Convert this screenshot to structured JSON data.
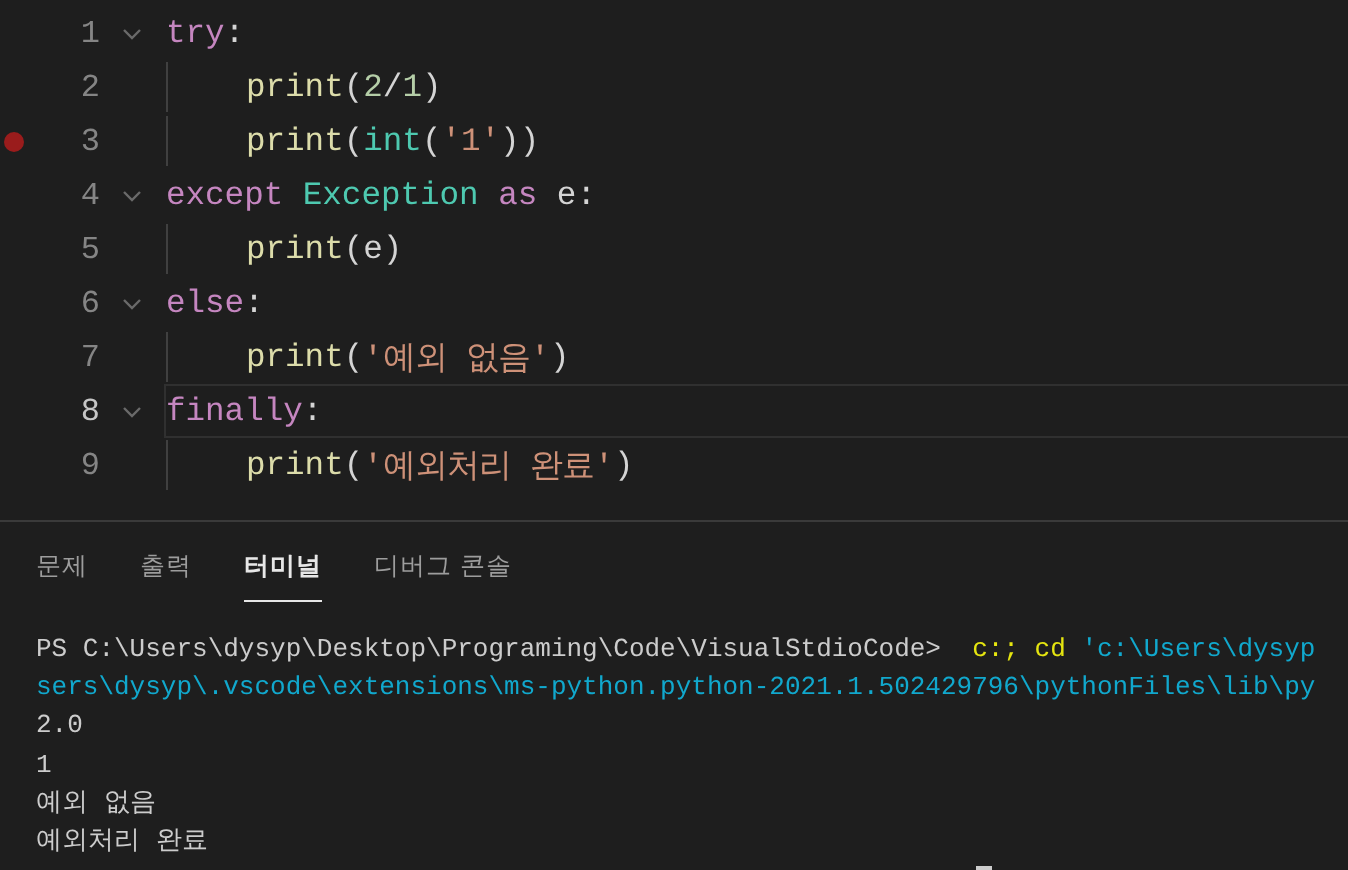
{
  "editor": {
    "lines": [
      {
        "number": "1",
        "foldable": true,
        "breakpoint": false,
        "current": false,
        "indented": false,
        "tokens": [
          {
            "kind": "keyword",
            "text": "try"
          },
          {
            "kind": "plain",
            "text": ":"
          }
        ]
      },
      {
        "number": "2",
        "foldable": false,
        "breakpoint": false,
        "current": false,
        "indented": true,
        "tokens": [
          {
            "kind": "func",
            "text": "print"
          },
          {
            "kind": "plain",
            "text": "("
          },
          {
            "kind": "number",
            "text": "2"
          },
          {
            "kind": "plain",
            "text": "/"
          },
          {
            "kind": "number",
            "text": "1"
          },
          {
            "kind": "plain",
            "text": ")"
          }
        ]
      },
      {
        "number": "3",
        "foldable": false,
        "breakpoint": true,
        "current": false,
        "indented": true,
        "tokens": [
          {
            "kind": "func",
            "text": "print"
          },
          {
            "kind": "plain",
            "text": "("
          },
          {
            "kind": "class",
            "text": "int"
          },
          {
            "kind": "plain",
            "text": "("
          },
          {
            "kind": "string",
            "text": "'1'"
          },
          {
            "kind": "plain",
            "text": "))"
          }
        ]
      },
      {
        "number": "4",
        "foldable": true,
        "breakpoint": false,
        "current": false,
        "indented": false,
        "tokens": [
          {
            "kind": "keyword",
            "text": "except"
          },
          {
            "kind": "class",
            "text": " Exception"
          },
          {
            "kind": "keyword",
            "text": " as"
          },
          {
            "kind": "plain",
            "text": " e:"
          }
        ]
      },
      {
        "number": "5",
        "foldable": false,
        "breakpoint": false,
        "current": false,
        "indented": true,
        "tokens": [
          {
            "kind": "func",
            "text": "print"
          },
          {
            "kind": "plain",
            "text": "(e)"
          }
        ]
      },
      {
        "number": "6",
        "foldable": true,
        "breakpoint": false,
        "current": false,
        "indented": false,
        "tokens": [
          {
            "kind": "keyword",
            "text": "else"
          },
          {
            "kind": "plain",
            "text": ":"
          }
        ]
      },
      {
        "number": "7",
        "foldable": false,
        "breakpoint": false,
        "current": false,
        "indented": true,
        "tokens": [
          {
            "kind": "func",
            "text": "print"
          },
          {
            "kind": "plain",
            "text": "("
          },
          {
            "kind": "string",
            "text": "'예외 없음'"
          },
          {
            "kind": "plain",
            "text": ")"
          }
        ]
      },
      {
        "number": "8",
        "foldable": true,
        "breakpoint": false,
        "current": true,
        "indented": false,
        "tokens": [
          {
            "kind": "keyword",
            "text": "finally"
          },
          {
            "kind": "plain",
            "text": ":"
          }
        ]
      },
      {
        "number": "9",
        "foldable": false,
        "breakpoint": false,
        "current": false,
        "indented": true,
        "tokens": [
          {
            "kind": "func",
            "text": "print"
          },
          {
            "kind": "plain",
            "text": "("
          },
          {
            "kind": "string",
            "text": "'예외처리 완료'"
          },
          {
            "kind": "plain",
            "text": ")"
          }
        ]
      }
    ]
  },
  "panel": {
    "tabs": [
      {
        "label": "문제",
        "selected": false
      },
      {
        "label": "출력",
        "selected": false
      },
      {
        "label": "터미널",
        "selected": true
      },
      {
        "label": "디버그 콘솔",
        "selected": false
      }
    ],
    "terminal": [
      [
        {
          "kind": "plain",
          "text": "PS C:\\Users\\dysyp\\Desktop\\Programing\\Code\\VisualStdioCode>  "
        },
        {
          "kind": "command",
          "text": "c:; cd"
        },
        {
          "kind": "arg",
          "text": " 'c:\\Users\\dysyp"
        }
      ],
      [
        {
          "kind": "arg",
          "text": "sers\\dysyp\\.vscode\\extensions\\ms-python.python-2021.1.502429796\\pythonFiles\\lib\\py"
        }
      ],
      [
        {
          "kind": "plain",
          "text": "2.0"
        }
      ],
      [
        {
          "kind": "plain",
          "text": "1"
        }
      ],
      [
        {
          "kind": "plain",
          "text": "예외 없음"
        }
      ],
      [
        {
          "kind": "plain",
          "text": "예외처리 완료"
        }
      ]
    ]
  }
}
